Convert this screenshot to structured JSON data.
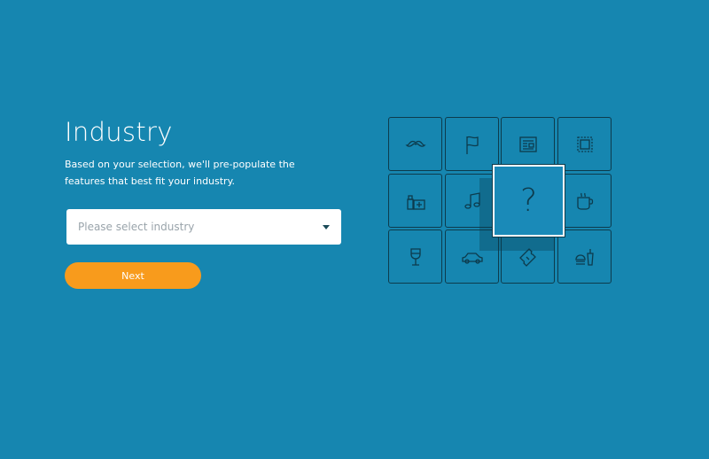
{
  "header": {
    "title": "Industry",
    "description": "Based on your selection, we'll pre-populate the features that best fit your industry."
  },
  "industry_select": {
    "placeholder": "Please select industry"
  },
  "actions": {
    "next_label": "Next"
  },
  "icon_grid": {
    "focused_symbol": "?",
    "tiles": [
      "mustache-icon",
      "flag-icon",
      "newspaper-icon",
      "stamp-icon",
      "pharmacy-icon",
      "music-note-icon",
      "question-icon",
      "coffee-cup-icon",
      "wine-glass-icon",
      "car-icon",
      "ticket-icon",
      "fast-food-icon"
    ]
  },
  "colors": {
    "background": "#1686b0",
    "button": "#f89b1c",
    "icon_stroke": "#0d3b4c"
  }
}
